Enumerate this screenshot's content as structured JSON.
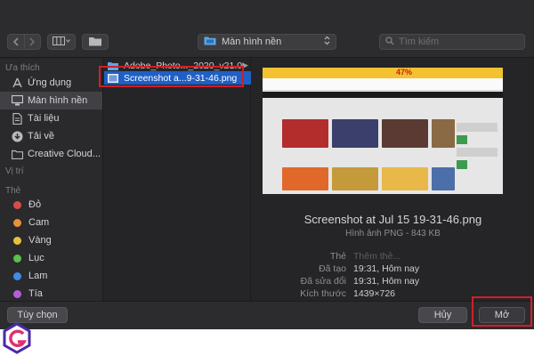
{
  "toolbar": {
    "back_icon": "chevron-left-icon",
    "forward_icon": "chevron-right-icon",
    "view_icon": "column-view-icon",
    "folder_icon": "folder-icon",
    "location_label": "Màn hình nền",
    "search_placeholder": "Tìm kiếm"
  },
  "sidebar": {
    "favorites_title": "Ưa thích",
    "favorites": [
      {
        "label": "Ứng dụng",
        "icon": "applications-icon"
      },
      {
        "label": "Màn hình nền",
        "icon": "desktop-icon",
        "active": true
      },
      {
        "label": "Tài liệu",
        "icon": "documents-icon"
      },
      {
        "label": "Tải về",
        "icon": "downloads-icon"
      },
      {
        "label": "Creative Cloud...",
        "icon": "folder-icon"
      }
    ],
    "locations_title": "Vị trí",
    "tags_title": "Thẻ",
    "tags": [
      {
        "label": "Đỏ",
        "color": "#d94b47"
      },
      {
        "label": "Cam",
        "color": "#e8903a"
      },
      {
        "label": "Vàng",
        "color": "#e6c23a"
      },
      {
        "label": "Lục",
        "color": "#5cbf4d"
      },
      {
        "label": "Lam",
        "color": "#3f8ce8"
      },
      {
        "label": "Tía",
        "color": "#b45ed6"
      }
    ]
  },
  "files": [
    {
      "name": "Adobe_Photo..._2020_v21.0",
      "type": "folder"
    },
    {
      "name": "Screenshot a...9-31-46.png",
      "type": "image",
      "selected": true
    }
  ],
  "preview": {
    "thumb_promo": "47%",
    "file_title": "Screenshot at Jul 15 19-31-46.png",
    "file_subtitle": "Hình ảnh PNG - 843 KB",
    "meta": [
      {
        "key": "Thẻ",
        "value": "Thêm thẻ...",
        "placeholder": true
      },
      {
        "key": "Đã tạo",
        "value": "19:31, Hôm nay"
      },
      {
        "key": "Đã sửa đổi",
        "value": "19:31, Hôm nay"
      },
      {
        "key": "Kích thước",
        "value": "1439×726"
      }
    ]
  },
  "bottom": {
    "options_label": "Tùy chọn",
    "cancel_label": "Hủy",
    "open_label": "Mở"
  },
  "colors": {
    "selection": "#1f5fc6",
    "highlight_box": "#d21f26"
  }
}
